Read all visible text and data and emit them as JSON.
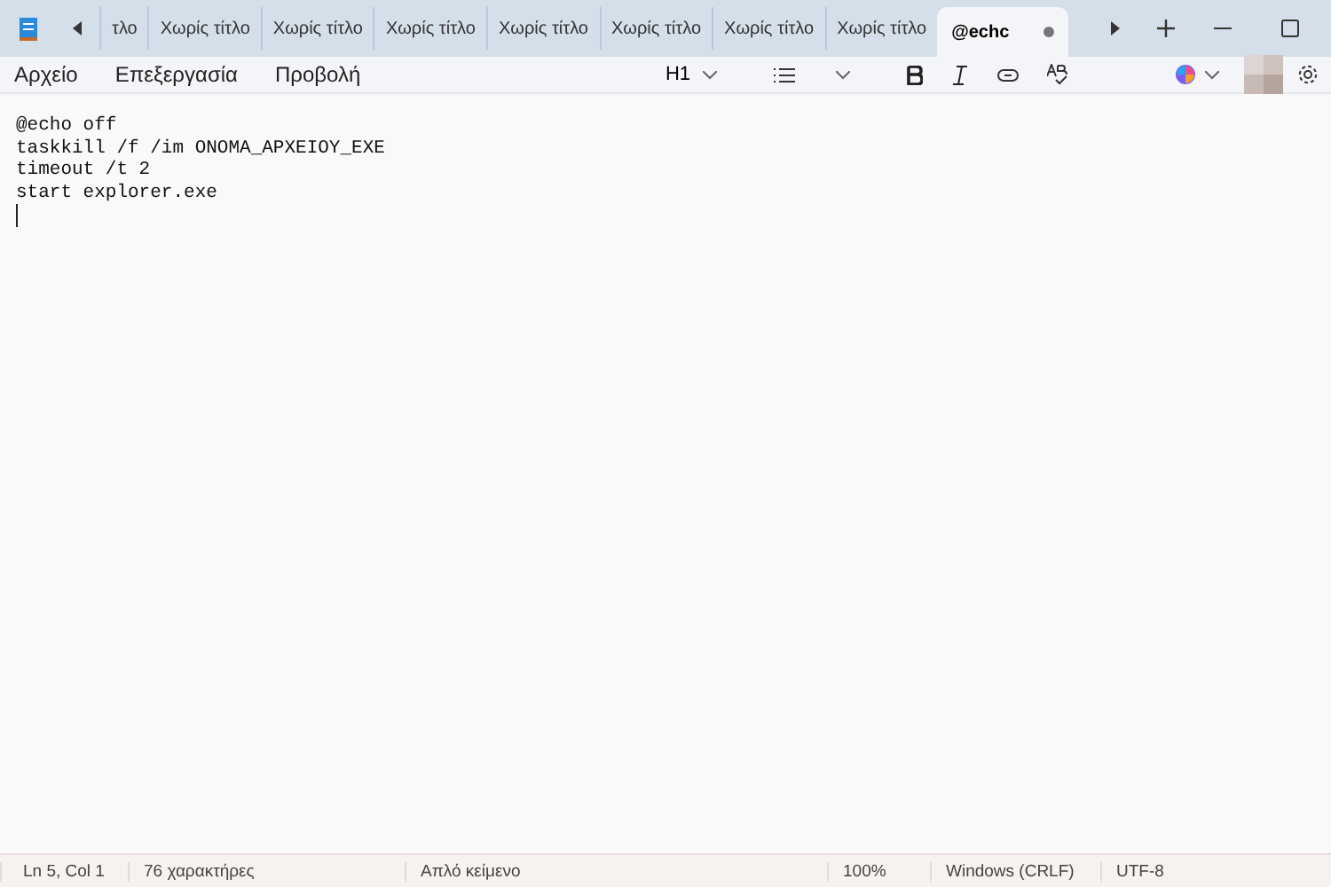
{
  "tabs": [
    {
      "label": "τλο",
      "selected": false,
      "modified": false
    },
    {
      "label": "Χωρίς τίτλο",
      "selected": false,
      "modified": false
    },
    {
      "label": "Χωρίς τίτλο",
      "selected": false,
      "modified": false
    },
    {
      "label": "Χωρίς τίτλο",
      "selected": false,
      "modified": false
    },
    {
      "label": "Χωρίς τίτλο",
      "selected": false,
      "modified": false
    },
    {
      "label": "Χωρίς τίτλο",
      "selected": false,
      "modified": false
    },
    {
      "label": "Χωρίς τίτλο",
      "selected": false,
      "modified": false
    },
    {
      "label": "Χωρίς τίτλο",
      "selected": false,
      "modified": false
    },
    {
      "label": "@echc",
      "selected": true,
      "modified": true
    }
  ],
  "menu": [
    "Αρχείο",
    "Επεξεργασία",
    "Προβολή"
  ],
  "toolbar": {
    "heading": "H1"
  },
  "editor": {
    "lines": [
      "@echo off",
      "taskkill /f /im ONOMA_APXEIOY_EXE",
      "timeout /t 2",
      "start explorer.exe"
    ]
  },
  "status_bar": {
    "position": "Ln 5, Col 1",
    "characters": "76 χαρακτήρες",
    "format": "Απλό κείμενο",
    "zoom": "100%",
    "line_endings": "Windows (CRLF)",
    "encoding": "UTF-8"
  }
}
